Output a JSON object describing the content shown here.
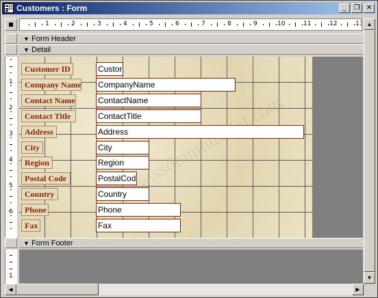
{
  "window": {
    "title": "Customers : Form",
    "buttons": {
      "minimize": "_",
      "restore": "❐",
      "close": "✕"
    }
  },
  "ruler": {
    "h_numbers": [
      "1",
      "2",
      "3",
      "4",
      "5",
      "6",
      "7",
      "8",
      "9",
      "10",
      "11",
      "12",
      "13"
    ],
    "v_numbers": [
      "1",
      "2",
      "3",
      "4",
      "5",
      "6"
    ],
    "v_footer_number": "1"
  },
  "sections": {
    "header": "Form Header",
    "detail": "Detail",
    "footer": "Form Footer",
    "arrow": "🠗"
  },
  "watermark": "www.ssdramtutorial.com",
  "fields": [
    {
      "label": "Customer ID",
      "control": "Custor"
    },
    {
      "label": "Company Name",
      "control": "CompanyName"
    },
    {
      "label": "Contact Name",
      "control": "ContactName"
    },
    {
      "label": "Contact Title",
      "control": "ContactTitle"
    },
    {
      "label": "Address",
      "control": "Address"
    },
    {
      "label": "City",
      "control": "City"
    },
    {
      "label": "Region",
      "control": "Region"
    },
    {
      "label": "Postal Code",
      "control": "PostalCod"
    },
    {
      "label": "Country",
      "control": "Country"
    },
    {
      "label": "Phone",
      "control": "Phone"
    },
    {
      "label": "Fax",
      "control": "Fax"
    }
  ],
  "scroll": {
    "up": "▲",
    "down": "▼",
    "left": "◀",
    "right": "▶"
  }
}
